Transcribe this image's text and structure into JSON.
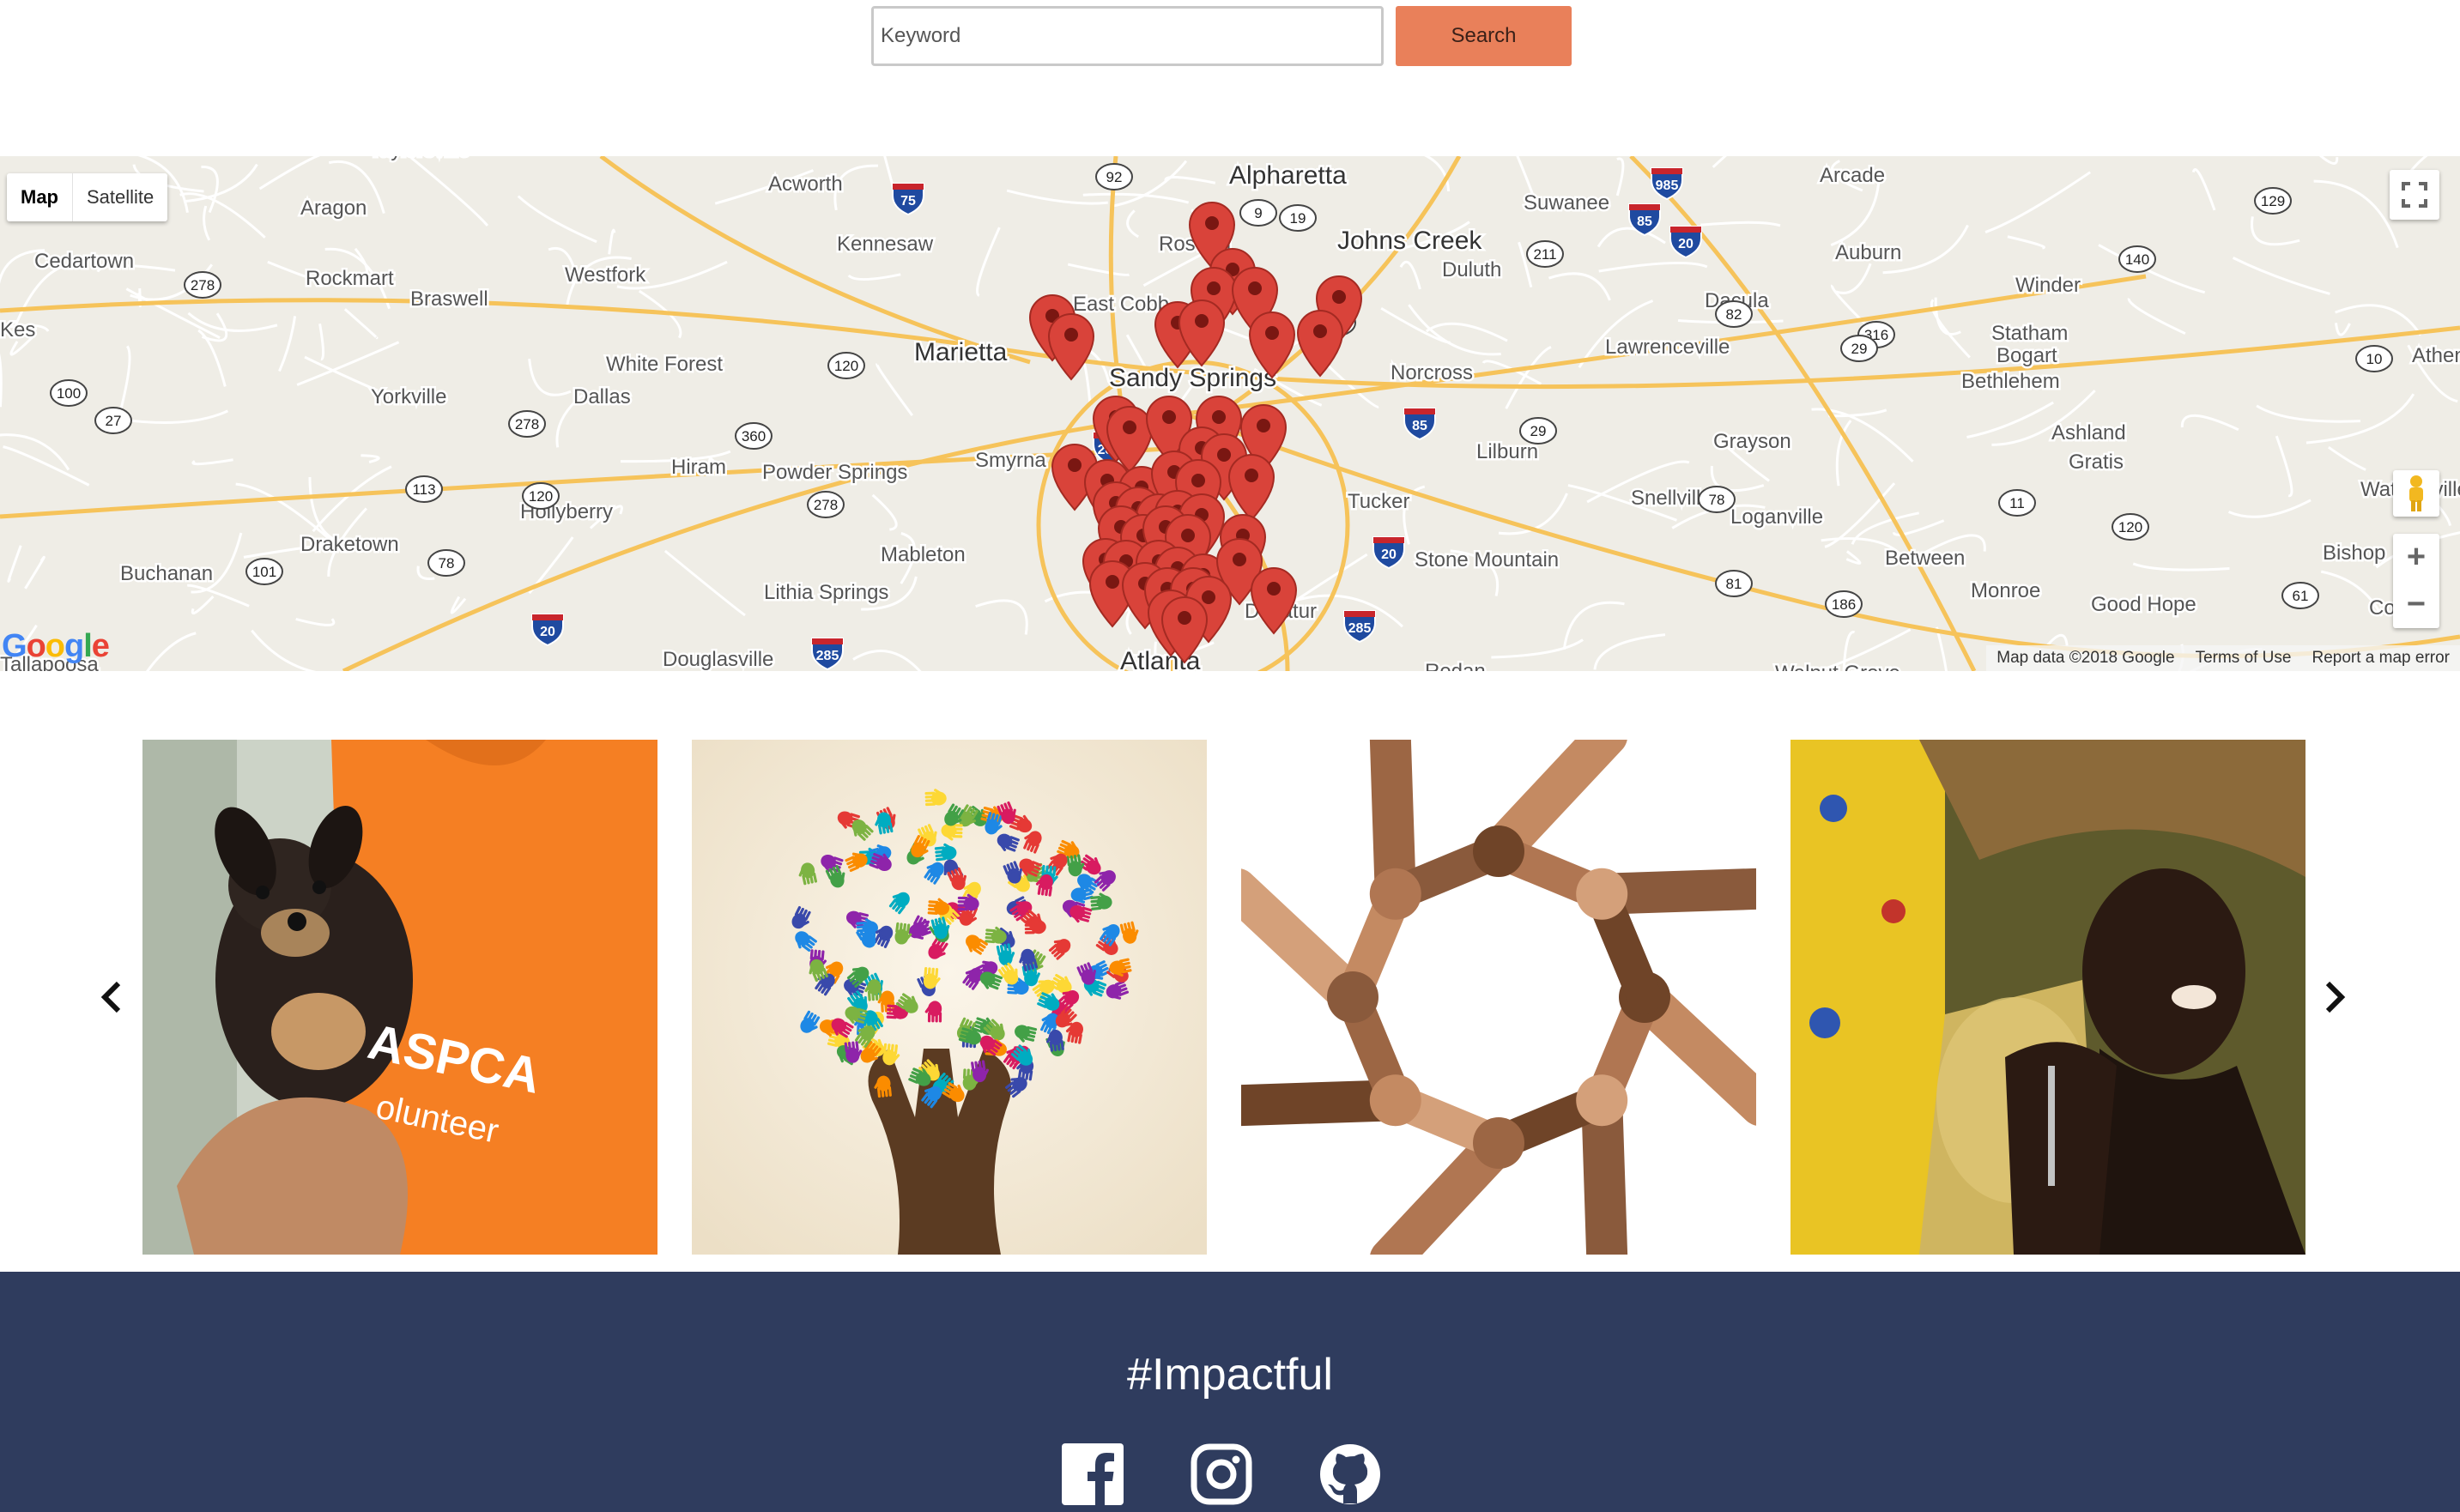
{
  "search": {
    "placeholder": "Keyword",
    "button_label": "Search"
  },
  "map": {
    "type_buttons": [
      "Map",
      "Satellite"
    ],
    "google_logo": "Google",
    "attribution": {
      "data": "Map data ©2018 Google",
      "terms": "Terms of Use",
      "report": "Report a map error"
    },
    "place_labels": [
      "Taylorsville",
      "Aragon",
      "Cedartown",
      "Rockmart",
      "Braswell",
      "Acworth",
      "Kennesaw",
      "Westfork",
      "Alpharetta",
      "Roswell",
      "Johns Creek",
      "Suwanee",
      "Arcade",
      "Duluth",
      "Auburn",
      "Winder",
      "East Cobb",
      "Marietta",
      "Sandy Springs",
      "Norcross",
      "Dacula",
      "Statham",
      "Lawrenceville",
      "Bogart",
      "White Forest",
      "Yorkville",
      "Dallas",
      "Bethlehem",
      "Hiram",
      "Smyrna",
      "Lilburn",
      "Grayson",
      "Ashland",
      "Gratis",
      "Powder Springs",
      "Hollyberry",
      "Tucker",
      "Snellville",
      "Loganville",
      "Watkinsville",
      "Draketown",
      "Mableton",
      "Stone Mountain",
      "Between",
      "Bishop",
      "Buchanan",
      "Lithia Springs",
      "Monroe",
      "Good Hope",
      "Douglasville",
      "Atlanta",
      "Decatur",
      "Redan",
      "Walnut Grove",
      "Kes",
      "Athens",
      "Co",
      "Tallapoosa"
    ],
    "highway_shields": [
      "92",
      "9",
      "19",
      "75",
      "985",
      "85",
      "20",
      "129",
      "278",
      "140",
      "23",
      "211",
      "82",
      "316",
      "29",
      "10",
      "120",
      "100",
      "27",
      "278",
      "360",
      "285",
      "85",
      "29",
      "78",
      "113",
      "120",
      "278",
      "11",
      "78",
      "120",
      "101",
      "78",
      "20",
      "81",
      "186",
      "61",
      "20",
      "285",
      "285"
    ]
  },
  "carousel": {
    "prev_icon": "chevron-left-icon",
    "next_icon": "chevron-right-icon",
    "slides": [
      {
        "subject": "puppy-volunteer",
        "shirt_text_1": "ASPCA",
        "shirt_text_2": "olunteer"
      },
      {
        "subject": "hands-tree"
      },
      {
        "subject": "linked-arms-circle"
      },
      {
        "subject": "water-pouring"
      }
    ]
  },
  "footer": {
    "title": "#Impactful",
    "social_icons": [
      "facebook-icon",
      "instagram-icon",
      "github-icon"
    ]
  },
  "colors": {
    "search_button": "#e9805a",
    "footer_bg": "#2f3c5e",
    "marker": "#d9433a"
  }
}
